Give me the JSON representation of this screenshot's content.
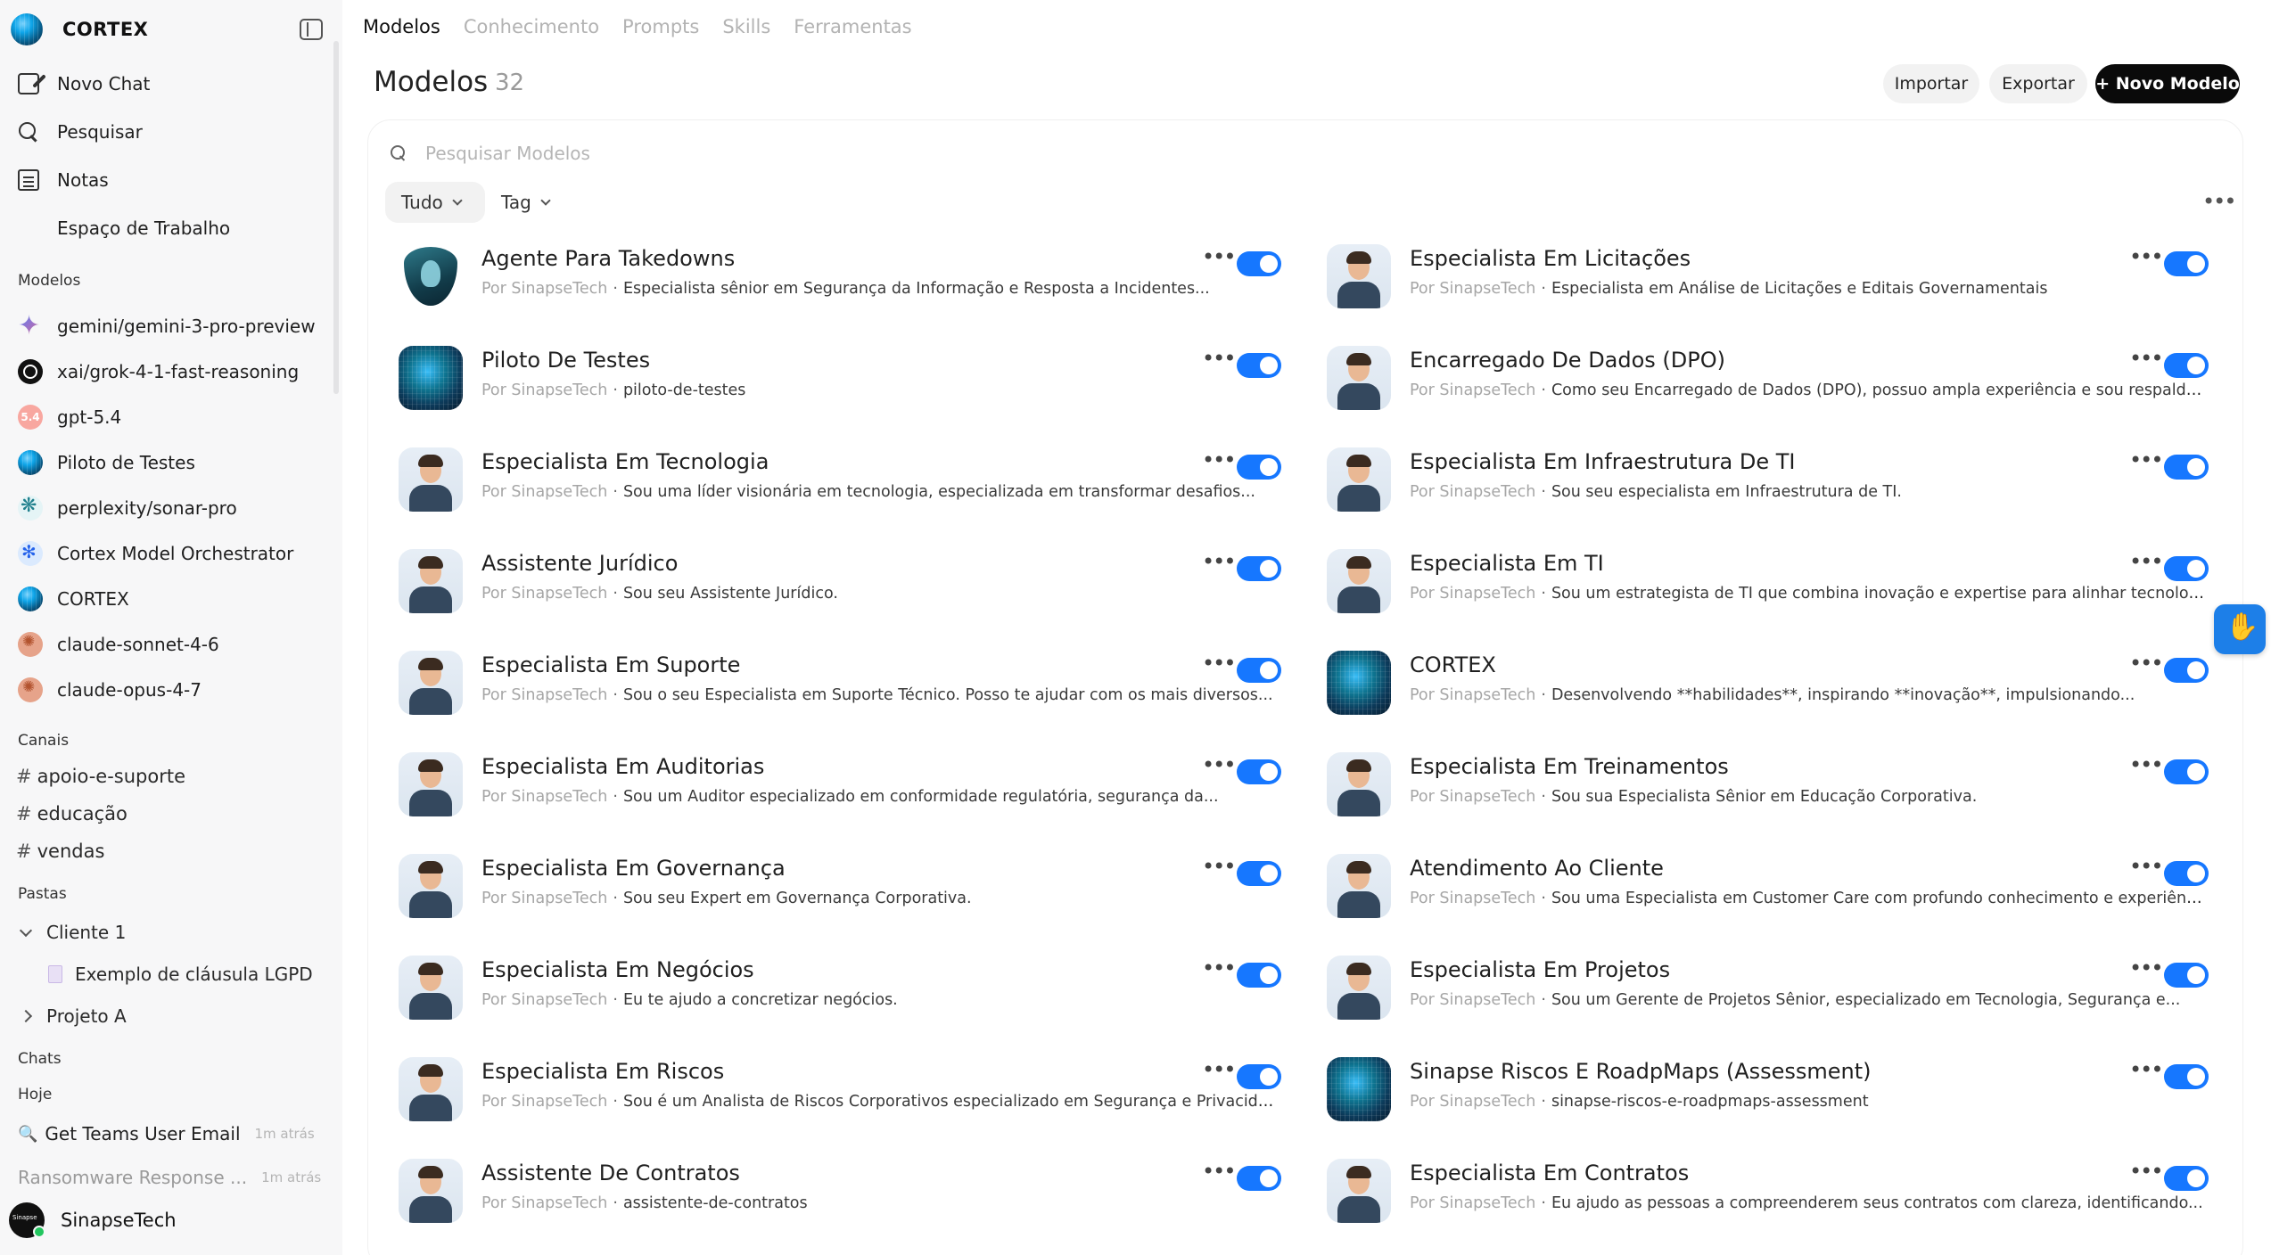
{
  "app": {
    "title": "CORTEX"
  },
  "sidebar": {
    "nav": [
      {
        "label": "Novo Chat",
        "icon": "pencil-square-icon"
      },
      {
        "label": "Pesquisar",
        "icon": "search-icon"
      },
      {
        "label": "Notas",
        "icon": "notes-icon"
      },
      {
        "label": "Espaço de Trabalho",
        "icon": "workspace-icon"
      }
    ],
    "models_heading": "Modelos",
    "models": [
      {
        "label": "gemini/gemini-3-pro-preview",
        "icon": "gemini-icon"
      },
      {
        "label": "xai/grok-4-1-fast-reasoning",
        "icon": "grok-icon"
      },
      {
        "label": "gpt-5.4",
        "icon": "gpt-icon",
        "badge": "5.4"
      },
      {
        "label": "Piloto de Testes",
        "icon": "globe-icon"
      },
      {
        "label": "perplexity/sonar-pro",
        "icon": "perplexity-icon"
      },
      {
        "label": "Cortex Model Orchestrator",
        "icon": "orchestrator-icon"
      },
      {
        "label": "CORTEX",
        "icon": "globe-icon"
      },
      {
        "label": "claude-sonnet-4-6",
        "icon": "claude-icon"
      },
      {
        "label": "claude-opus-4-7",
        "icon": "claude-icon"
      }
    ],
    "channels_heading": "Canais",
    "channels": [
      "apoio-e-suporte",
      "educação",
      "vendas"
    ],
    "folders_heading": "Pastas",
    "folders": [
      {
        "label": "Cliente 1",
        "expanded": true,
        "children": [
          "Exemplo de cláusula LGPD"
        ]
      },
      {
        "label": "Projeto A",
        "expanded": false
      }
    ],
    "chats_heading": "Chats",
    "chats_group": "Hoje",
    "chats": [
      {
        "title": "Get Teams User Email",
        "time": "1m atrás"
      },
      {
        "title": "Ransomware Response ...",
        "time": "1m atrás"
      }
    ],
    "user": {
      "name": "SinapseTech",
      "status": "online"
    }
  },
  "main": {
    "tabs": [
      {
        "label": "Modelos",
        "active": true
      },
      {
        "label": "Conhecimento",
        "active": false
      },
      {
        "label": "Prompts",
        "active": false
      },
      {
        "label": "Skills",
        "active": false
      },
      {
        "label": "Ferramentas",
        "active": false
      }
    ],
    "title": "Modelos",
    "count": "32",
    "buttons": {
      "import": "Importar",
      "export": "Exportar",
      "new_model": "+ Novo Modelo"
    },
    "search": {
      "placeholder": "Pesquisar Modelos",
      "value": ""
    },
    "filters": {
      "scope": "Tudo",
      "tag": "Tag"
    },
    "by_label": "Por SinapseTech",
    "models": [
      {
        "name": "Agente Para Takedowns",
        "desc": "Especialista sênior em Segurança da Informação e Resposta a Incidentes...",
        "enabled": true,
        "avatar": "shield"
      },
      {
        "name": "Especialista Em Licitações",
        "desc": "Especialista em Análise de Licitações e Editais Governamentais",
        "enabled": true,
        "avatar": "person"
      },
      {
        "name": "Piloto De Testes",
        "desc": "piloto-de-testes",
        "enabled": true,
        "avatar": "globe"
      },
      {
        "name": "Encarregado De Dados (DPO)",
        "desc": "Como seu Encarregado de Dados (DPO), possuo ampla experiência e sou respalda...",
        "enabled": true,
        "avatar": "person"
      },
      {
        "name": "Especialista Em Tecnologia",
        "desc": "Sou uma líder visionária em tecnologia, especializada em transformar desafios...",
        "enabled": true,
        "avatar": "person"
      },
      {
        "name": "Especialista Em Infraestrutura De TI",
        "desc": "Sou seu especialista em Infraestrutura de TI.",
        "enabled": true,
        "avatar": "person"
      },
      {
        "name": "Assistente Jurídico",
        "desc": "Sou seu Assistente Jurídico.",
        "enabled": true,
        "avatar": "person"
      },
      {
        "name": "Especialista Em TI",
        "desc": "Sou um estrategista de TI que combina inovação e expertise para alinhar tecnologi...",
        "enabled": true,
        "avatar": "person"
      },
      {
        "name": "Especialista Em Suporte",
        "desc": "Sou o seu Especialista em Suporte Técnico. Posso te ajudar com os mais diversos...",
        "enabled": true,
        "avatar": "person"
      },
      {
        "name": "CORTEX",
        "desc": "Desenvolvendo **habilidades**, inspirando **inovação**, impulsionando...",
        "enabled": true,
        "avatar": "globe"
      },
      {
        "name": "Especialista Em Auditorias",
        "desc": "Sou um Auditor especializado em conformidade regulatória, segurança da...",
        "enabled": true,
        "avatar": "person"
      },
      {
        "name": "Especialista Em Treinamentos",
        "desc": "Sou sua Especialista Sênior em Educação Corporativa.",
        "enabled": true,
        "avatar": "person"
      },
      {
        "name": "Especialista Em Governança",
        "desc": "Sou seu Expert em Governança Corporativa.",
        "enabled": true,
        "avatar": "person"
      },
      {
        "name": "Atendimento Ao Cliente",
        "desc": "Sou uma Especialista em Customer Care com profundo conhecimento e experiênci...",
        "enabled": true,
        "avatar": "person"
      },
      {
        "name": "Especialista Em Negócios",
        "desc": "Eu te ajudo a concretizar negócios.",
        "enabled": true,
        "avatar": "person"
      },
      {
        "name": "Especialista Em Projetos",
        "desc": "Sou um Gerente de Projetos Sênior, especializado em Tecnologia, Segurança e...",
        "enabled": true,
        "avatar": "person"
      },
      {
        "name": "Especialista Em Riscos",
        "desc": "Sou é um Analista de Riscos Corporativos especializado em Segurança e Privacida...",
        "enabled": true,
        "avatar": "person"
      },
      {
        "name": "Sinapse Riscos E RoadpMaps (Assessment)",
        "desc": "sinapse-riscos-e-roadpmaps-assessment",
        "enabled": true,
        "avatar": "globe"
      },
      {
        "name": "Assistente De Contratos",
        "desc": "assistente-de-contratos",
        "enabled": true,
        "avatar": "person"
      },
      {
        "name": "Especialista Em Contratos",
        "desc": "Eu ajudo as pessoas a compreenderem seus contratos com clareza, identificando...",
        "enabled": true,
        "avatar": "person"
      }
    ]
  },
  "colors": {
    "accent": "#1677ff",
    "primary_button": "#0a0a0a",
    "sidebar_bg": "#f7f7f8"
  }
}
